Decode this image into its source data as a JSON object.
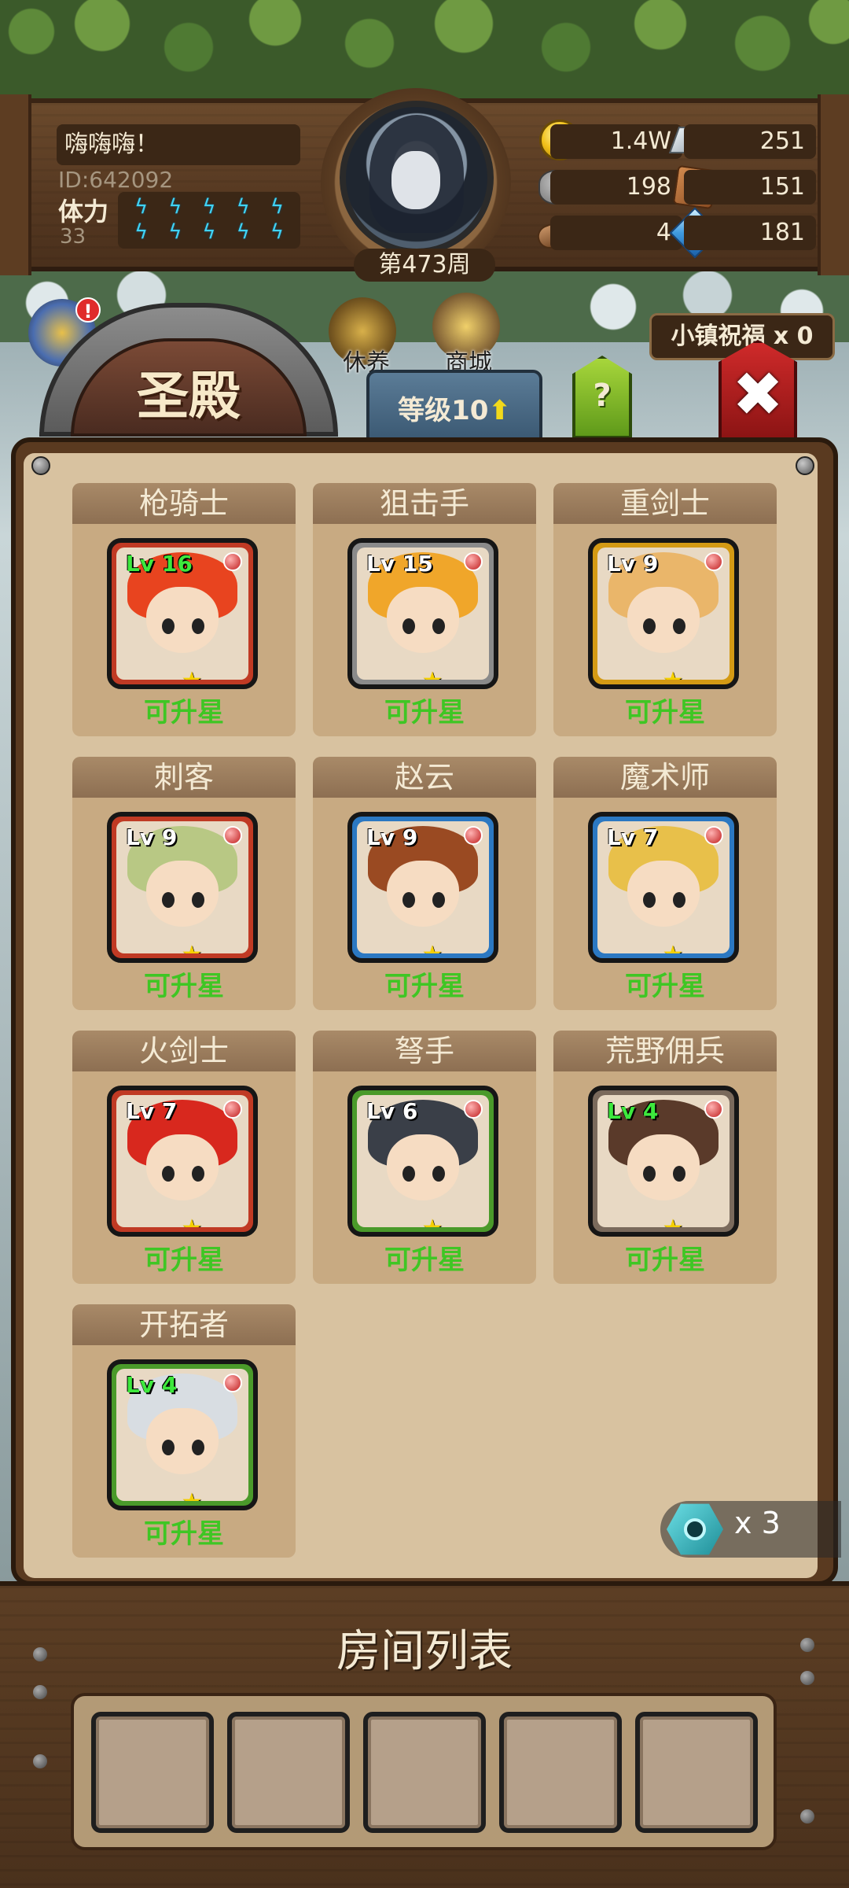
{
  "player": {
    "name": "嗨嗨嗨！",
    "id": "ID:642092",
    "stamina_label": "体力",
    "stamina_value": "33",
    "stamina_bolts": 10,
    "week": "第473周"
  },
  "resources": {
    "gold": "1.4W",
    "iron": "251",
    "stone": "198",
    "leather": "151",
    "wood": "4",
    "crystal": "181"
  },
  "menu": {
    "rest_label": "休养",
    "shop_label": "商城",
    "alert_mark": "!",
    "blessing": "小镇祝福 x 0"
  },
  "building": {
    "title": "圣殿",
    "level_label": "等级10",
    "level_arrow": "⬆",
    "help": "?",
    "close": "✖"
  },
  "heroes": [
    {
      "name": "枪骑士",
      "level": "Lv 16",
      "level_green": true,
      "status": "可升星",
      "frame": "#c03a24",
      "hair": "#e8441f"
    },
    {
      "name": "狙击手",
      "level": "Lv 15",
      "level_green": false,
      "status": "可升星",
      "frame": "#8a8a8a",
      "hair": "#f0a62a"
    },
    {
      "name": "重剑士",
      "level": "Lv 9",
      "level_green": false,
      "status": "可升星",
      "frame": "#d49a14",
      "hair": "#eab66a"
    },
    {
      "name": "刺客",
      "level": "Lv 9",
      "level_green": false,
      "status": "可升星",
      "frame": "#c03a24",
      "hair": "#b8c884"
    },
    {
      "name": "赵云",
      "level": "Lv 9",
      "level_green": false,
      "status": "可升星",
      "frame": "#2b78c2",
      "hair": "#9a4a22"
    },
    {
      "name": "魔术师",
      "level": "Lv 7",
      "level_green": false,
      "status": "可升星",
      "frame": "#2b78c2",
      "hair": "#e8c04a"
    },
    {
      "name": "火剑士",
      "level": "Lv 7",
      "level_green": false,
      "status": "可升星",
      "frame": "#c03a24",
      "hair": "#d8281e"
    },
    {
      "name": "弩手",
      "level": "Lv 6",
      "level_green": false,
      "status": "可升星",
      "frame": "#4a9a2a",
      "hair": "#3a3f48"
    },
    {
      "name": "荒野佣兵",
      "level": "Lv 4",
      "level_green": true,
      "status": "可升星",
      "frame": "#7a6a5c",
      "hair": "#5a3a2a"
    },
    {
      "name": "开拓者",
      "level": "Lv 4",
      "level_green": true,
      "status": "可升星",
      "frame": "#4a9a2a",
      "hair": "#d8dde2"
    }
  ],
  "star_glyph": "★",
  "ticket": {
    "count": "x 3"
  },
  "rooms": {
    "title": "房间列表",
    "slots": 5
  }
}
